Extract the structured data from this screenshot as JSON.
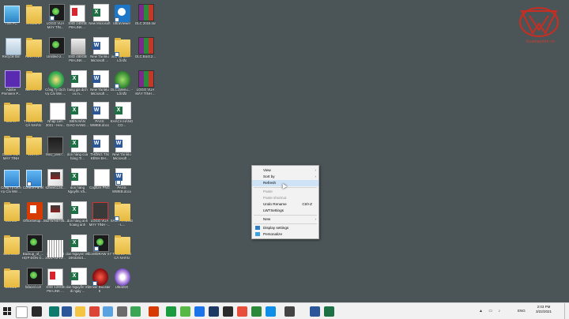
{
  "desktop": {
    "icons": [
      {
        "label": "This PC",
        "type": "pc"
      },
      {
        "label": "EXCEL 1",
        "type": "folder"
      },
      {
        "label": "LOGO VUA MÁY TÍN...",
        "type": "corel",
        "shortcut": true
      },
      {
        "label": "SSD 240GB PB-LINK ...",
        "type": "ssd"
      },
      {
        "label": "New Microsoft ...",
        "type": "excel"
      },
      {
        "label": "UltraViewer",
        "type": "blue",
        "shortcut": true
      },
      {
        "label": "DLC 2015.rar",
        "type": "rar"
      },
      {
        "label": "Recycle Bin",
        "type": "recycle"
      },
      {
        "label": "HINH ANH",
        "type": "folder"
      },
      {
        "label": "Untitled-2...",
        "type": "corel"
      },
      {
        "label": "SSD 480GB PB-LINK ...",
        "type": "drive"
      },
      {
        "label": "New Tài liệu Microsoft ...",
        "type": "word"
      },
      {
        "label": "anh-co-tra... - Lối tắt",
        "type": "folder",
        "shortcut": true
      },
      {
        "label": "DLC.Boot.2...",
        "type": "rar"
      },
      {
        "label": "Adobe Premiere P...",
        "type": "adobe"
      },
      {
        "label": "NOTEPAD",
        "type": "folder"
      },
      {
        "label": "Công Ty Dịch Vụ Cài Win ...",
        "type": "circle"
      },
      {
        "label": "bang gia dịch vu m...",
        "type": "excel"
      },
      {
        "label": "New Tài liệu Microsoft ...",
        "type": "word"
      },
      {
        "label": "DLC1Menu... - Lối tắt",
        "type": "ball",
        "shortcut": true
      },
      {
        "label": "LOGO VUA MÁY TÍNH ...",
        "type": "rar"
      },
      {
        "label": "ảnh in",
        "type": "folder"
      },
      {
        "label": "THÔNG TIN CÁ NHÂN",
        "type": "folder"
      },
      {
        "label": "Nhap Lieh 2021 - Hev...",
        "type": "file"
      },
      {
        "label": "BIÊN BẢN GIAO HANG...",
        "type": "excel"
      },
      {
        "label": "PASS WWEB.docx",
        "type": "word"
      },
      {
        "label": "KHÁCH HÀNG CO...",
        "type": "excel"
      },
      {
        "label": "CODE VUA MÁY TÍNH",
        "type": "folder"
      },
      {
        "label": "WORK",
        "type": "folder"
      },
      {
        "label": "IMG_2997...",
        "type": "shot"
      },
      {
        "label": "don hàng của hàng Tr...",
        "type": "excel"
      },
      {
        "label": "THÔNG TIN KÊNH BH...",
        "type": "word"
      },
      {
        "label": "New Tài liệu Microsoft ...",
        "type": "word"
      },
      {
        "label": "Công Ty Dịch Vụ Cài Win ...",
        "type": "cp"
      },
      {
        "label": "Control Panel",
        "type": "cp",
        "shortcut": true
      },
      {
        "label": "625eeb136...",
        "type": "image"
      },
      {
        "label": "don hàng Nguyễn Vă...",
        "type": "excel"
      },
      {
        "label": "Capture.PNG",
        "type": "file"
      },
      {
        "label": "PASS WWEB.docx",
        "type": "word",
        "shortcut": true
      },
      {
        "label": "COREL",
        "type": "folder"
      },
      {
        "label": "OfficeSetup...",
        "type": "office"
      },
      {
        "label": "55275780705...",
        "type": "image"
      },
      {
        "label": "don hàng anh hoang anh Hoan Đ...",
        "type": "excel"
      },
      {
        "label": "LOGO VUA MÁY TÍNH -...",
        "type": "logo"
      },
      {
        "label": "SÁCH THÔNG - L...",
        "type": "folder",
        "shortcut": true
      },
      {
        "label": "DLC 2015",
        "type": "folder"
      },
      {
        "label": "Backup_of_... HỢP ĐỒN G...",
        "type": "corel"
      },
      {
        "label": "Screenshot 2021-03-13...",
        "type": "strip"
      },
      {
        "label": "don Nguyen Vũ 19032021...",
        "type": "excel"
      },
      {
        "label": "CorelDRAW X7",
        "type": "corel",
        "shortcut": true
      },
      {
        "label": "THÔNG TIN CÁ NHÂN",
        "type": "folder"
      },
      {
        "label": "EXCEL",
        "type": "folder"
      },
      {
        "label": "fafazaf.cdr",
        "type": "corel"
      },
      {
        "label": "SSD 120GB PB-LINK ...",
        "type": "ssd"
      },
      {
        "label": "don Nguyễn Vũ di ngày ...",
        "type": "excel"
      },
      {
        "label": "Driver Booster 8",
        "type": "red",
        "shortcut": true
      },
      {
        "label": "UltraISO",
        "type": "disc"
      }
    ]
  },
  "watermark": {
    "text": "Vuamaytinh.vn"
  },
  "context_menu": {
    "items": [
      {
        "label": "View",
        "submenu": true,
        "disabled": false
      },
      {
        "label": "Sort by",
        "submenu": true,
        "disabled": false
      },
      {
        "label": "Refresh",
        "disabled": false,
        "highlighted": true
      },
      {
        "sep": true
      },
      {
        "label": "Paste",
        "disabled": true
      },
      {
        "label": "Paste shortcut",
        "disabled": true
      },
      {
        "label": "Undo Rename",
        "shortcut": "Ctrl+Z",
        "disabled": false
      },
      {
        "label": "LWTSettings",
        "disabled": false
      },
      {
        "sep": true
      },
      {
        "label": "New",
        "submenu": true,
        "disabled": false
      },
      {
        "sep": true
      },
      {
        "label": "Display settings",
        "icon": "display-icon",
        "disabled": false
      },
      {
        "label": "Personalize",
        "icon": "personalize-icon",
        "disabled": false
      }
    ]
  },
  "taskbar": {
    "apps": [
      {
        "name": "search-icon",
        "color": "#ffffff"
      },
      {
        "name": "task-view-icon",
        "color": "#2b2b2b"
      },
      {
        "name": "edge-icon",
        "color": "#0f7b6c"
      },
      {
        "name": "photos-icon",
        "color": "#2b579a"
      },
      {
        "name": "file-explorer-icon",
        "color": "#f4c542"
      },
      {
        "name": "chrome-icon",
        "color": "#db4437"
      },
      {
        "name": "paint-icon",
        "color": "#5ba3e0"
      },
      {
        "name": "app-icon",
        "color": "#6b6b6b"
      },
      {
        "name": "camtasia-icon",
        "color": "#3aa655"
      },
      {
        "name": "office-icon",
        "color": "#d83b01"
      },
      {
        "name": "corel-icon",
        "color": "#1a9c3e"
      },
      {
        "name": "coccoc-icon",
        "color": "#57b846"
      },
      {
        "name": "zalo-icon",
        "color": "#1a73e8"
      },
      {
        "name": "photoshop-icon",
        "color": "#1c3a63"
      },
      {
        "name": "app2-icon",
        "color": "#2b2b2b"
      },
      {
        "name": "app3-icon",
        "color": "#e94e3c"
      },
      {
        "name": "corel2-icon",
        "color": "#2a8a3a"
      },
      {
        "name": "teamviewer-icon",
        "color": "#0e8ee9"
      },
      {
        "name": "app4-icon",
        "color": "#444444"
      },
      {
        "name": "word-icon",
        "color": "#2b579a"
      },
      {
        "name": "excel-icon",
        "color": "#1e7145"
      }
    ],
    "lang": "ENG",
    "time": "2:03 PM",
    "date": "3/22/2021"
  }
}
